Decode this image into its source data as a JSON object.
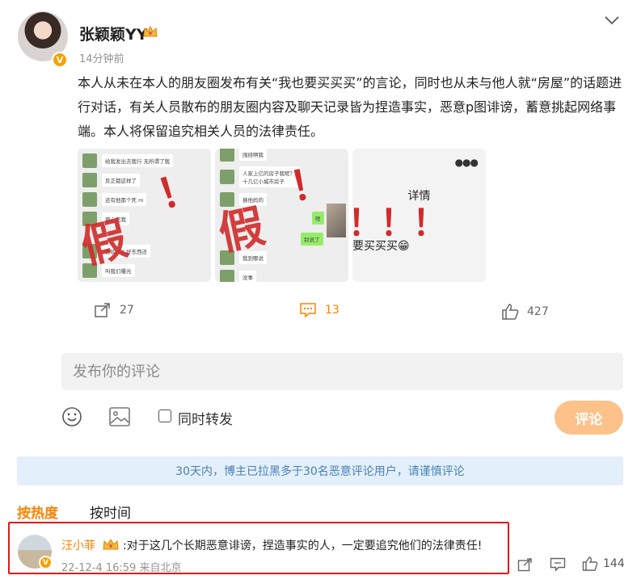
{
  "post": {
    "username": "张颖颖YY",
    "time": "14分钟前",
    "body": "本人从未在本人的朋友圈发布有关“我也要买买买”的言论，同时也从未与他人就“房屋”的话题进行对话，有关人员散布的朋友圈内容及聊天记录皆为捏造事实，恶意p图诽谤，蓄意挑起网络事端。本人将保留追究相关人员的法律责任。",
    "images": [
      {
        "chat": [
          "给我发出去我行 无所谓了我",
          "反正都这样了",
          "还有他那个死 m",
          "爽心死我",
          "喜欢什么好东西还",
          "叫我们曝光"
        ],
        "stamp": "假",
        "bang": "！"
      },
      {
        "chat": [
          "围绕啊我",
          "人家上亿的房子我呢？十几亿小城市房子",
          "换他妈的",
          "我到哪说",
          "没事"
        ],
        "green": [
          "嗯",
          "别说了"
        ],
        "stamp": "假",
        "bang": "！"
      },
      {
        "detail_label": "详情",
        "buy_text": "要买买买😁",
        "bang": "！！！"
      }
    ]
  },
  "actions": {
    "forward_count": "27",
    "comment_count": "13",
    "like_count": "427"
  },
  "composer": {
    "placeholder": "发布你的评论",
    "repost_label": "同时转发",
    "submit_label": "评论"
  },
  "notice": "30天内，博主已拉黑多于30名恶意评论用户，请谨慎评论",
  "sort": {
    "hot": "按热度",
    "time": "按时间"
  },
  "top_comment": {
    "name": "汪小菲",
    "text": ":对于这几个长期恶意诽谤，捏造事实的人，一定要追究他们的法律责任!",
    "time": "22-12-4 16:59 来自北京",
    "like_count": "144"
  },
  "colors": {
    "accent": "#ff8200",
    "notice_bg": "#e3f0fb",
    "highlight_frame": "#e0191b"
  }
}
